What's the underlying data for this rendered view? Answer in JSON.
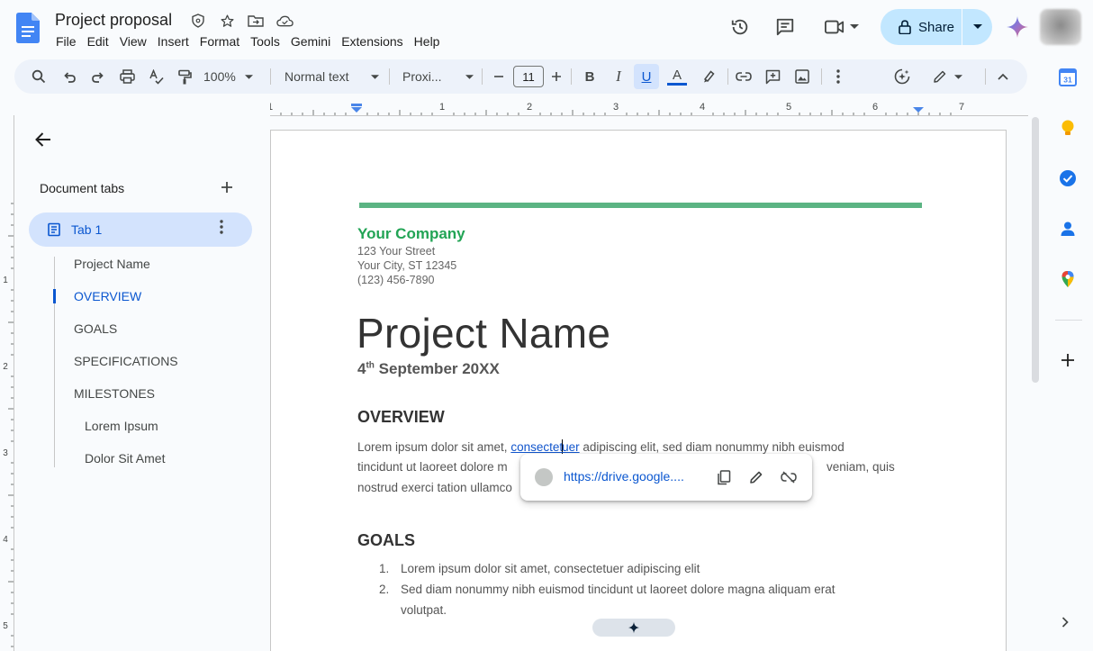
{
  "header": {
    "title": "Project proposal",
    "menu": [
      "File",
      "Edit",
      "View",
      "Insert",
      "Format",
      "Tools",
      "Gemini",
      "Extensions",
      "Help"
    ],
    "share_label": "Share"
  },
  "toolbar": {
    "zoom": "100%",
    "style": "Normal text",
    "font": "Proxi...",
    "font_size": "11"
  },
  "ruler": {
    "ticks": [
      "1",
      "1",
      "2",
      "3",
      "4",
      "5",
      "6",
      "7"
    ],
    "left_ticks": [
      "1",
      "2",
      "3",
      "4",
      "5"
    ]
  },
  "sidebar": {
    "heading": "Document tabs",
    "tab": "Tab 1",
    "outline": [
      {
        "label": "Project Name",
        "level": 1
      },
      {
        "label": "OVERVIEW",
        "level": 1,
        "active": true
      },
      {
        "label": "GOALS",
        "level": 1
      },
      {
        "label": "SPECIFICATIONS",
        "level": 1
      },
      {
        "label": "MILESTONES",
        "level": 1
      },
      {
        "label": "Lorem Ipsum",
        "level": 2
      },
      {
        "label": "Dolor Sit Amet",
        "level": 2
      }
    ]
  },
  "document": {
    "company": "Your Company",
    "address": [
      "123 Your Street",
      "Your City, ST 12345",
      "(123) 456-7890"
    ],
    "title": "Project Name",
    "date_day": "4",
    "date_suffix": "th",
    "date_rest": " September 20XX",
    "overview_heading": "OVERVIEW",
    "overview_line1_before": "Lorem ipsum dolor sit amet, ",
    "overview_link_a": "consectet",
    "overview_link_b": "uer",
    "overview_line1_after": " adipiscing elit, sed diam nonummy nibh euismod",
    "overview_line2_left": "tincidunt ut laoreet dolore m",
    "overview_line2_right": "veniam, quis",
    "overview_line3_left": "nostrud exerci tation ullamco",
    "goals_heading": "GOALS",
    "goals": [
      {
        "num": "1.",
        "lines": [
          "Lorem ipsum dolor sit amet, consectetuer adipiscing elit"
        ]
      },
      {
        "num": "2.",
        "lines": [
          "Sed diam nonummy nibh euismod tincidunt ut laoreet dolore magna aliquam erat",
          "volutpat."
        ]
      }
    ]
  },
  "link_popup": {
    "url": "https://drive.google...."
  },
  "colors": {
    "accent": "#0b57d0",
    "share_bg": "#c2e7ff",
    "company_green": "#22a455",
    "bar_green": "#5bb483"
  }
}
